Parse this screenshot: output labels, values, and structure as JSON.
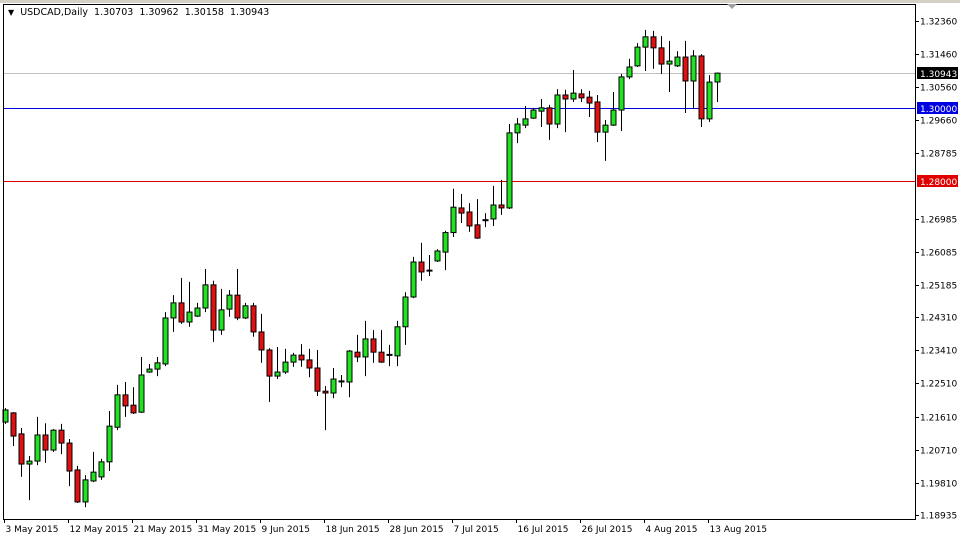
{
  "header": {
    "symbol_timeframe": "USDCAD,Daily",
    "open": "1.30703",
    "high": "1.30962",
    "low": "1.30158",
    "close": "1.30943"
  },
  "colors": {
    "bull": "#22e022",
    "bear": "#e01010",
    "current_line": "#c0c0c0",
    "level_blue": "#0000e0",
    "level_red": "#e00000"
  },
  "chart_data": {
    "type": "candlestick",
    "title": "USDCAD,Daily",
    "ylim": [
      1.18935,
      1.3236
    ],
    "y_ticks": [
      "1.32360",
      "1.31460",
      "1.30560",
      "1.29660",
      "1.28785",
      "1.26985",
      "1.26085",
      "1.25185",
      "1.24310",
      "1.23410",
      "1.22510",
      "1.21610",
      "1.20710",
      "1.19810",
      "1.18935"
    ],
    "x_labels": [
      {
        "bar": 0,
        "label": "3 May 2015"
      },
      {
        "bar": 8,
        "label": "12 May 2015"
      },
      {
        "bar": 16,
        "label": "21 May 2015"
      },
      {
        "bar": 24,
        "label": "31 May 2015"
      },
      {
        "bar": 32,
        "label": "9 Jun 2015"
      },
      {
        "bar": 40,
        "label": "18 Jun 2015"
      },
      {
        "bar": 48,
        "label": "28 Jun 2015"
      },
      {
        "bar": 56,
        "label": "7 Jul 2015"
      },
      {
        "bar": 64,
        "label": "16 Jul 2015"
      },
      {
        "bar": 72,
        "label": "26 Jul 2015"
      },
      {
        "bar": 80,
        "label": "4 Aug 2015"
      },
      {
        "bar": 88,
        "label": "13 Aug 2015"
      }
    ],
    "price_lines": [
      {
        "name": "current-price",
        "value": 1.30943,
        "label": "1.30943",
        "color": "#c0c0c0",
        "tag_color": "#000000"
      },
      {
        "name": "level-1-30000",
        "value": 1.3,
        "label": "1.30000",
        "color": "#0000e0",
        "tag_color": "#0000e0"
      },
      {
        "name": "level-1-28000",
        "value": 1.28,
        "label": "1.28000",
        "color": "#e00000",
        "tag_color": "#e00000"
      }
    ],
    "ohlc_fields": [
      "open",
      "high",
      "low",
      "close"
    ],
    "ohlc": [
      [
        1.2146,
        1.2184,
        1.2141,
        1.2179
      ],
      [
        1.2171,
        1.2173,
        1.2081,
        1.2108
      ],
      [
        1.2114,
        1.213,
        1.1997,
        1.2032
      ],
      [
        1.2032,
        1.2054,
        1.1934,
        1.204
      ],
      [
        1.204,
        1.216,
        1.2029,
        1.2111
      ],
      [
        1.2111,
        1.2143,
        1.2035,
        1.207
      ],
      [
        1.207,
        1.2127,
        1.2065,
        1.2124
      ],
      [
        1.2124,
        1.2141,
        1.2059,
        1.2089
      ],
      [
        1.2089,
        1.21,
        1.1972,
        1.2013
      ],
      [
        1.2016,
        1.2027,
        1.1926,
        1.1929
      ],
      [
        1.1929,
        1.2002,
        1.1915,
        1.1989
      ],
      [
        1.1986,
        1.2065,
        1.1983,
        1.201
      ],
      [
        1.1997,
        1.2046,
        1.1989,
        1.2038
      ],
      [
        1.2038,
        1.2176,
        1.2013,
        1.2135
      ],
      [
        1.2132,
        1.2247,
        1.2124,
        1.222
      ],
      [
        1.222,
        1.2255,
        1.216,
        1.219
      ],
      [
        1.2192,
        1.2241,
        1.2168,
        1.2171
      ],
      [
        1.2173,
        1.2323,
        1.2171,
        1.2274
      ],
      [
        1.2282,
        1.2304,
        1.228,
        1.229
      ],
      [
        1.229,
        1.2323,
        1.2271,
        1.2307
      ],
      [
        1.2304,
        1.2445,
        1.2298,
        1.2429
      ],
      [
        1.2429,
        1.2491,
        1.2391,
        1.247
      ],
      [
        1.247,
        1.2538,
        1.2413,
        1.2418
      ],
      [
        1.2418,
        1.2527,
        1.2405,
        1.2445
      ],
      [
        1.2434,
        1.247,
        1.2432,
        1.2456
      ],
      [
        1.2456,
        1.2562,
        1.2445,
        1.2519
      ],
      [
        1.2519,
        1.253,
        1.2364,
        1.2396
      ],
      [
        1.2396,
        1.2508,
        1.2383,
        1.2451
      ],
      [
        1.2453,
        1.2505,
        1.2432,
        1.2491
      ],
      [
        1.2491,
        1.2562,
        1.2423,
        1.2429
      ],
      [
        1.2429,
        1.247,
        1.2426,
        1.2462
      ],
      [
        1.2462,
        1.247,
        1.2378,
        1.2391
      ],
      [
        1.2391,
        1.244,
        1.2307,
        1.2342
      ],
      [
        1.2342,
        1.2347,
        1.2201,
        1.2271
      ],
      [
        1.2271,
        1.235,
        1.2263,
        1.2282
      ],
      [
        1.2282,
        1.2345,
        1.2277,
        1.2309
      ],
      [
        1.2309,
        1.2334,
        1.2296,
        1.2328
      ],
      [
        1.2328,
        1.2358,
        1.2296,
        1.2315
      ],
      [
        1.2315,
        1.2345,
        1.2268,
        1.2293
      ],
      [
        1.2293,
        1.2342,
        1.2217,
        1.223
      ],
      [
        1.223,
        1.2244,
        1.2124,
        1.2225
      ],
      [
        1.2225,
        1.2293,
        1.2211,
        1.2263
      ],
      [
        1.2255,
        1.2274,
        1.2241,
        1.2258
      ],
      [
        1.2255,
        1.2342,
        1.2214,
        1.2339
      ],
      [
        1.2336,
        1.2383,
        1.2309,
        1.2323
      ],
      [
        1.2323,
        1.2421,
        1.2271,
        1.2372
      ],
      [
        1.2372,
        1.2396,
        1.2307,
        1.2336
      ],
      [
        1.2336,
        1.2396,
        1.2307,
        1.2309
      ],
      [
        1.233,
        1.2356,
        1.2298,
        1.2328
      ],
      [
        1.2326,
        1.2421,
        1.2298,
        1.2405
      ],
      [
        1.2405,
        1.2499,
        1.2356,
        1.2486
      ],
      [
        1.2486,
        1.2595,
        1.2483,
        1.2581
      ],
      [
        1.2581,
        1.2633,
        1.253,
        1.2554
      ],
      [
        1.2557,
        1.26,
        1.2543,
        1.2559
      ],
      [
        1.2584,
        1.2616,
        1.2581,
        1.2611
      ],
      [
        1.2608,
        1.2666,
        1.2559,
        1.2661
      ],
      [
        1.2661,
        1.278,
        1.2649,
        1.273
      ],
      [
        1.2728,
        1.2766,
        1.2687,
        1.2714
      ],
      [
        1.2717,
        1.2741,
        1.2663,
        1.2679
      ],
      [
        1.2682,
        1.2752,
        1.2644,
        1.2646
      ],
      [
        1.2694,
        1.2714,
        1.2676,
        1.2696
      ],
      [
        1.2698,
        1.2788,
        1.2679,
        1.2736
      ],
      [
        1.2736,
        1.2804,
        1.2709,
        1.2728
      ],
      [
        1.2728,
        1.2956,
        1.2725,
        1.2932
      ],
      [
        1.2932,
        1.2972,
        1.2904,
        1.2956
      ],
      [
        1.2953,
        1.3005,
        1.2945,
        1.297
      ],
      [
        1.2972,
        1.3,
        1.297,
        1.2994
      ],
      [
        1.2991,
        1.3024,
        1.2948,
        1.3
      ],
      [
        1.3,
        1.3008,
        1.2913,
        1.2956
      ],
      [
        1.2956,
        1.3051,
        1.2945,
        1.3035
      ],
      [
        1.3035,
        1.3049,
        1.2934,
        1.3024
      ],
      [
        1.3024,
        1.3103,
        1.3016,
        1.304
      ],
      [
        1.3038,
        1.3051,
        1.3016,
        1.3027
      ],
      [
        1.3029,
        1.3046,
        1.2975,
        1.3013
      ],
      [
        1.3016,
        1.3035,
        1.2907,
        1.2934
      ],
      [
        1.2934,
        1.2967,
        1.2856,
        1.2953
      ],
      [
        1.2953,
        1.3043,
        1.2951,
        1.2994
      ],
      [
        1.2994,
        1.3092,
        1.2937,
        1.3084
      ],
      [
        1.3084,
        1.3133,
        1.3078,
        1.3111
      ],
      [
        1.3114,
        1.3176,
        1.3111,
        1.3165
      ],
      [
        1.3165,
        1.3212,
        1.31,
        1.3193
      ],
      [
        1.3193,
        1.3209,
        1.3106,
        1.3163
      ],
      [
        1.3163,
        1.3195,
        1.3092,
        1.3119
      ],
      [
        1.3119,
        1.3182,
        1.3043,
        1.3127
      ],
      [
        1.3114,
        1.3154,
        1.3111,
        1.3138
      ],
      [
        1.3138,
        1.3182,
        1.2986,
        1.3073
      ],
      [
        1.3073,
        1.3157,
        1.2997,
        1.3141
      ],
      [
        1.3141,
        1.3146,
        1.2948,
        1.297
      ],
      [
        1.297,
        1.3089,
        1.2962,
        1.307
      ],
      [
        1.30703,
        1.30962,
        1.30158,
        1.30943
      ]
    ]
  }
}
